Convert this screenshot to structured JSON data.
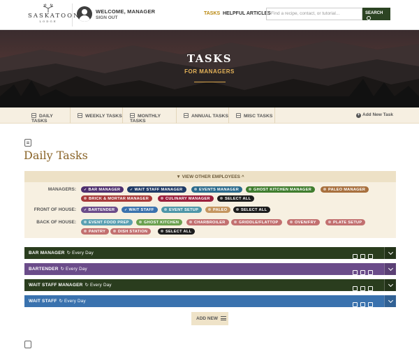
{
  "brand": {
    "name": "SASKATOON",
    "sub": "LODGE"
  },
  "user": {
    "welcome": "WELCOME, MANAGER",
    "signout": "SIGN OUT"
  },
  "nav": {
    "tasks": "TASKS",
    "articles": "HELPFUL ARTICLES"
  },
  "search": {
    "placeholder": "Find a recipe, contact, or tutorial...",
    "button": "SEARCH"
  },
  "hero": {
    "title": "TASKS",
    "subtitle": "FOR MANAGERS"
  },
  "tabs": [
    {
      "label": "DAILY TASKS"
    },
    {
      "label": "WEEKLY TASKS"
    },
    {
      "label": "MONTHLY TASKS"
    },
    {
      "label": "ANNUAL TASKS"
    },
    {
      "label": "MISC TASKS"
    }
  ],
  "add_task": "Add New Task",
  "page_title": "Daily Tasks",
  "filter": {
    "toggle": "VIEW OTHER EMPLOYEES",
    "managers_label": "MANAGERS:",
    "front_label": "FRONT OF HOUSE:",
    "back_label": "BACK OF HOUSE:",
    "managers": [
      "BAR MANAGER",
      "WAIT STAFF MANAGER",
      "EVENTS MANAGER",
      "GHOST KITCHEN MANAGER",
      "PALEO MANAGER",
      "BRICK & MORTAR MANAGER",
      "CULINARY MANAGER",
      "SELECT ALL"
    ],
    "front": [
      "BARTENDER",
      "WAIT STAFF",
      "EVENT SETUP",
      "PALEO",
      "SELECT ALL"
    ],
    "back": [
      "EVENT FOOD PREP",
      "GHOST KITCHEN",
      "CHARBROILER",
      "GRIDDLE/FLATTOP",
      "OVEN/FRY",
      "PLATE SETUP",
      "PANTRY",
      "DISH STATION",
      "SELECT ALL"
    ]
  },
  "task_groups": [
    {
      "name": "BAR MANAGER",
      "freq": "Every Day",
      "color": "#2a3d1e"
    },
    {
      "name": "BARTENDER",
      "freq": "Every Day",
      "color": "#6b4c8a"
    },
    {
      "name": "WAIT STAFF MANAGER",
      "freq": "Every Day",
      "color": "#2a3d1e"
    },
    {
      "name": "WAIT STAFF",
      "freq": "Every Day",
      "color": "#3a72ae"
    }
  ],
  "add_new": "ADD NEW"
}
